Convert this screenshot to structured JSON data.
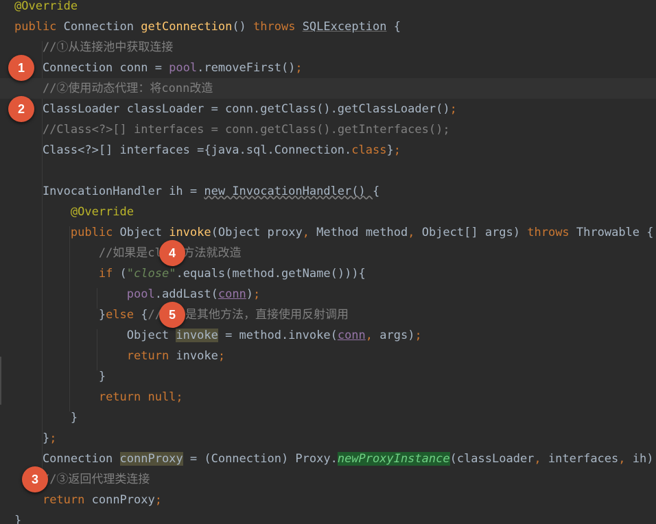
{
  "code_lines": [
    [
      {
        "t": "@Override",
        "c": "ann"
      }
    ],
    [
      {
        "t": "public ",
        "c": "kw"
      },
      {
        "t": "Connection "
      },
      {
        "t": "getConnection",
        "c": "fn"
      },
      {
        "t": "() "
      },
      {
        "t": "throws ",
        "c": "kw"
      },
      {
        "t": "SQLException",
        "c": "ul-red"
      },
      {
        "t": " {"
      }
    ],
    [
      {
        "t": "    "
      },
      {
        "t": "//①从连接池中获取连接",
        "c": "cm"
      }
    ],
    [
      {
        "t": "    Connection conn = "
      },
      {
        "t": "pool",
        "c": "pf"
      },
      {
        "t": ".removeFirst()"
      },
      {
        "t": ";",
        "c": "punc"
      }
    ],
    [
      {
        "t": "    "
      },
      {
        "t": "//②使用动态代理：将conn改造",
        "c": "cm"
      }
    ],
    [
      {
        "t": "    ClassLoader classLoader = conn.getClass().getClassLoader()"
      },
      {
        "t": ";",
        "c": "punc"
      }
    ],
    [
      {
        "t": "    "
      },
      {
        "t": "//Class<?>[] interfaces = conn.getClass().getInterfaces();",
        "c": "cm"
      }
    ],
    [
      {
        "t": "    Class<?>[] interfaces ={java.sql.Connection."
      },
      {
        "t": "class",
        "c": "kw"
      },
      {
        "t": "}"
      },
      {
        "t": ";",
        "c": "punc"
      }
    ],
    [
      {
        "t": ""
      }
    ],
    [
      {
        "t": "    InvocationHandler ih = "
      },
      {
        "t": "new InvocationHandler() ",
        "c": "ul-wave"
      },
      {
        "t": "{"
      }
    ],
    [
      {
        "t": "        "
      },
      {
        "t": "@Override",
        "c": "ann"
      }
    ],
    [
      {
        "t": "        "
      },
      {
        "t": "public ",
        "c": "kw"
      },
      {
        "t": "Object "
      },
      {
        "t": "invoke",
        "c": "fn"
      },
      {
        "t": "(Object proxy"
      },
      {
        "t": ", ",
        "c": "punc"
      },
      {
        "t": "Method method"
      },
      {
        "t": ", ",
        "c": "punc"
      },
      {
        "t": "Object[] args) "
      },
      {
        "t": "throws ",
        "c": "kw"
      },
      {
        "t": "Throwable {"
      }
    ],
    [
      {
        "t": "            "
      },
      {
        "t": "//如果是close方法就改造",
        "c": "cm"
      }
    ],
    [
      {
        "t": "            "
      },
      {
        "t": "if ",
        "c": "kw"
      },
      {
        "t": "("
      },
      {
        "t": "\"close\"",
        "c": "str"
      },
      {
        "t": ".equals(method.getName())){"
      }
    ],
    [
      {
        "t": "                "
      },
      {
        "t": "pool",
        "c": "pf"
      },
      {
        "t": ".addLast("
      },
      {
        "t": "conn",
        "c": "pf ul-capture"
      },
      {
        "t": ")"
      },
      {
        "t": ";",
        "c": "punc"
      }
    ],
    [
      {
        "t": "            }"
      },
      {
        "t": "else ",
        "c": "kw"
      },
      {
        "t": "{"
      },
      {
        "t": "//如果是其他方法，直接使用反射调用",
        "c": "cm"
      }
    ],
    [
      {
        "t": "                Object "
      },
      {
        "t": "invoke",
        "c": "hl-var"
      },
      {
        "t": " = method.invoke("
      },
      {
        "t": "conn",
        "c": "pf ul-capture"
      },
      {
        "t": ", ",
        "c": "punc"
      },
      {
        "t": "args)"
      },
      {
        "t": ";",
        "c": "punc"
      }
    ],
    [
      {
        "t": "                "
      },
      {
        "t": "return ",
        "c": "kw"
      },
      {
        "t": "invoke"
      },
      {
        "t": ";",
        "c": "punc"
      }
    ],
    [
      {
        "t": "            }"
      }
    ],
    [
      {
        "t": "            "
      },
      {
        "t": "return null",
        "c": "kw"
      },
      {
        "t": ";",
        "c": "punc"
      }
    ],
    [
      {
        "t": "        }"
      }
    ],
    [
      {
        "t": "    }"
      },
      {
        "t": ";",
        "c": "punc"
      }
    ],
    [
      {
        "t": "    Connection "
      },
      {
        "t": "connProxy",
        "c": "hl-var"
      },
      {
        "t": " = (Connection) Proxy."
      },
      {
        "t": "newProxyInstance",
        "c": "hl-green"
      },
      {
        "t": "(classLoader"
      },
      {
        "t": ", ",
        "c": "punc"
      },
      {
        "t": "interfaces"
      },
      {
        "t": ", ",
        "c": "punc"
      },
      {
        "t": "ih)"
      },
      {
        "t": ";",
        "c": "punc"
      }
    ],
    [
      {
        "t": "    "
      },
      {
        "t": "//③返回代理类连接",
        "c": "cm"
      }
    ],
    [
      {
        "t": "    "
      },
      {
        "t": "return ",
        "c": "kw"
      },
      {
        "t": "connProxy"
      },
      {
        "t": ";",
        "c": "punc"
      }
    ],
    [
      {
        "t": "}"
      }
    ]
  ],
  "markers": [
    {
      "label": "1",
      "line": 3,
      "col": 1.0
    },
    {
      "label": "2",
      "line": 5,
      "col": 1.0
    },
    {
      "label": "3",
      "line": 23,
      "col": 1.5
    },
    {
      "label": "4",
      "line": 12,
      "col": 6.5
    },
    {
      "label": "5",
      "line": 15,
      "col": 6.5
    }
  ],
  "current_line": 4,
  "colors": {
    "background": "#2b2b2b",
    "marker": "#e1573a",
    "keyword": "#cc7832",
    "annotation": "#bbb529",
    "method": "#ffc66d",
    "field": "#9876aa",
    "comment": "#808080",
    "string": "#6a8759"
  }
}
